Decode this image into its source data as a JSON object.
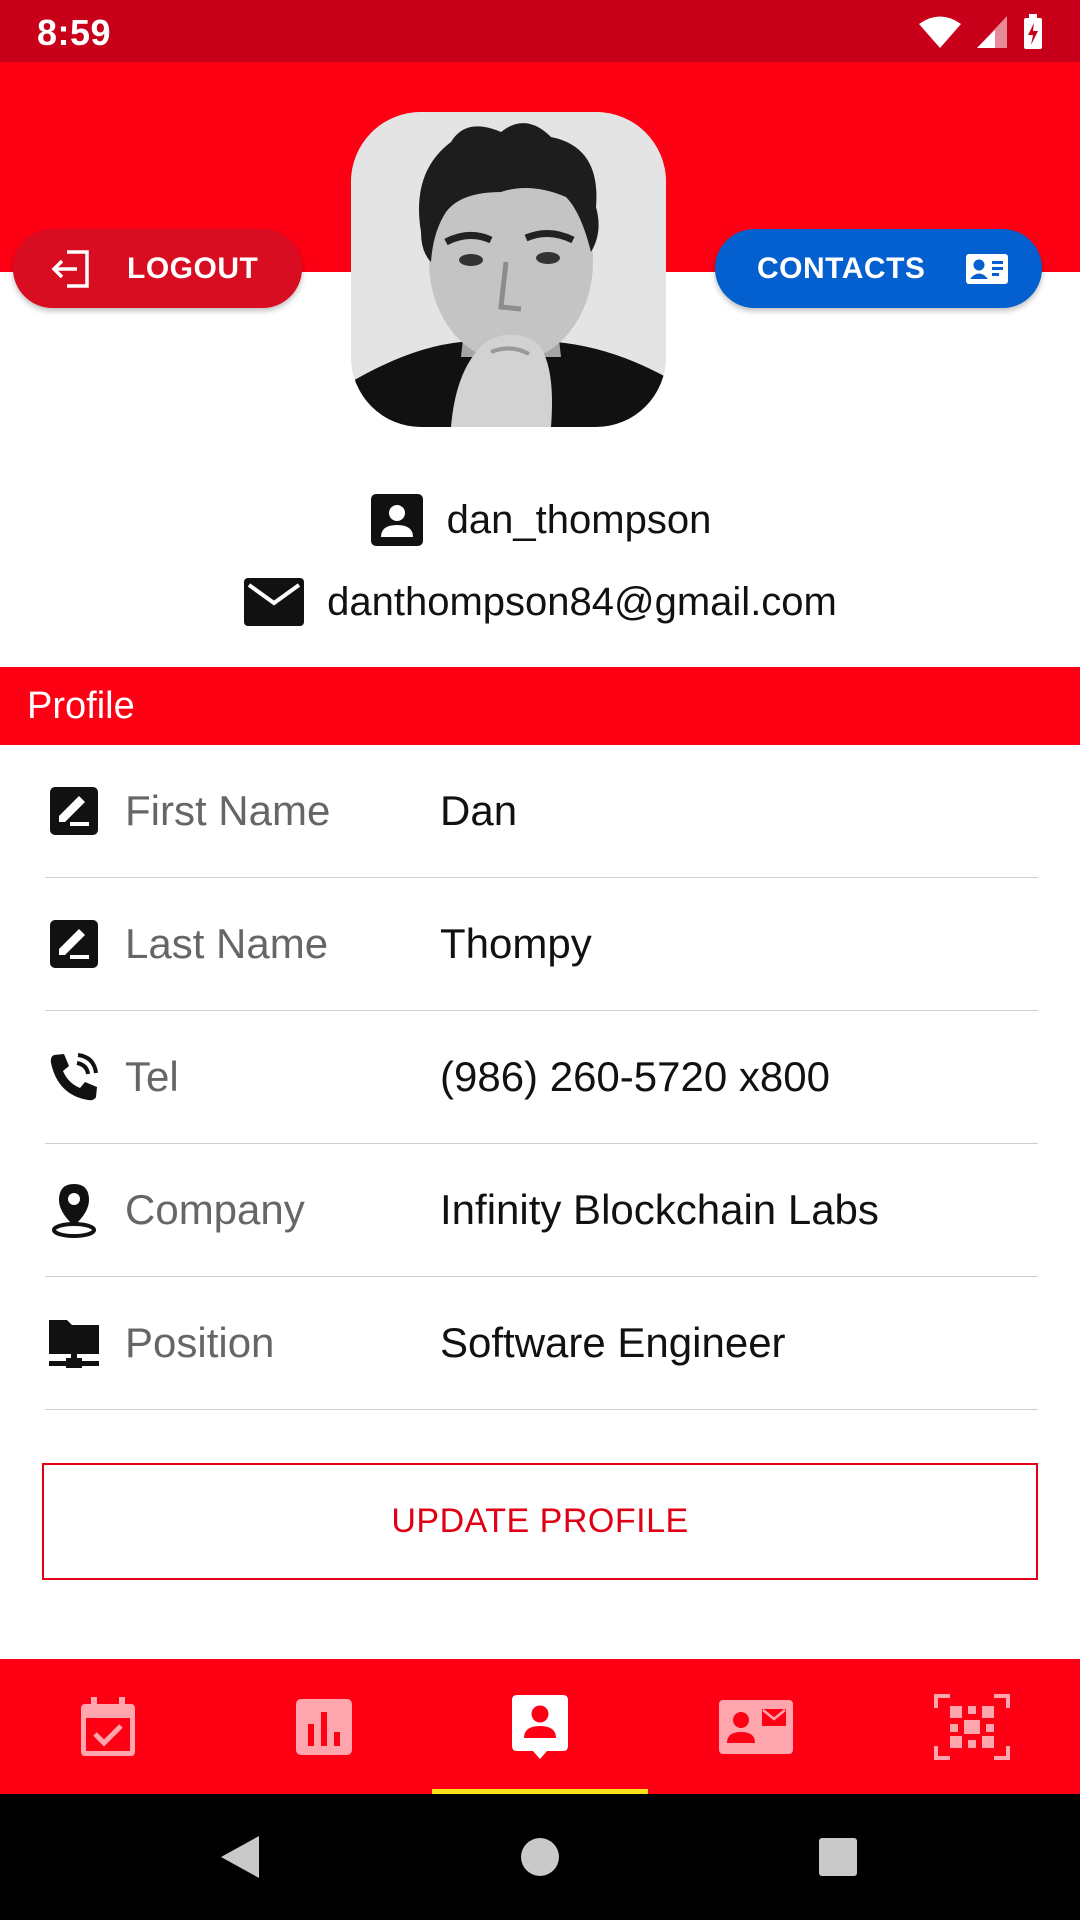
{
  "status_bar": {
    "time": "8:59",
    "icons": [
      "wifi-icon",
      "signal-icon",
      "battery-charging-icon"
    ]
  },
  "header": {
    "logout_label": "LOGOUT",
    "contacts_label": "CONTACTS",
    "colors": {
      "header_red": "#fe0014",
      "logout_red": "#d80d22",
      "contacts_blue": "#0460ce"
    }
  },
  "identity": {
    "username": "dan_thompson",
    "email": "danthompson84@gmail.com"
  },
  "profile": {
    "section_title": "Profile",
    "fields": [
      {
        "icon": "edit-box-icon",
        "label": "First Name",
        "value": "Dan"
      },
      {
        "icon": "edit-box-icon",
        "label": "Last Name",
        "value": "Thompy"
      },
      {
        "icon": "phone-in-talk-icon",
        "label": "Tel",
        "value": "(986) 260-5720 x800"
      },
      {
        "icon": "map-pin-icon",
        "label": "Company",
        "value": "Infinity Blockchain Labs"
      },
      {
        "icon": "folder-network-icon",
        "label": "Position",
        "value": "Software Engineer"
      }
    ],
    "update_label": "UPDATE PROFILE"
  },
  "bottom_nav": {
    "items": [
      {
        "icon": "calendar-check-icon",
        "active": false
      },
      {
        "icon": "bar-chart-icon",
        "active": false
      },
      {
        "icon": "account-box-icon",
        "active": true
      },
      {
        "icon": "contact-mail-icon",
        "active": false
      },
      {
        "icon": "qr-code-icon",
        "active": false
      }
    ],
    "indicator_color": "#ffe21a"
  },
  "system_nav": [
    "back-icon",
    "home-icon",
    "recents-icon"
  ]
}
